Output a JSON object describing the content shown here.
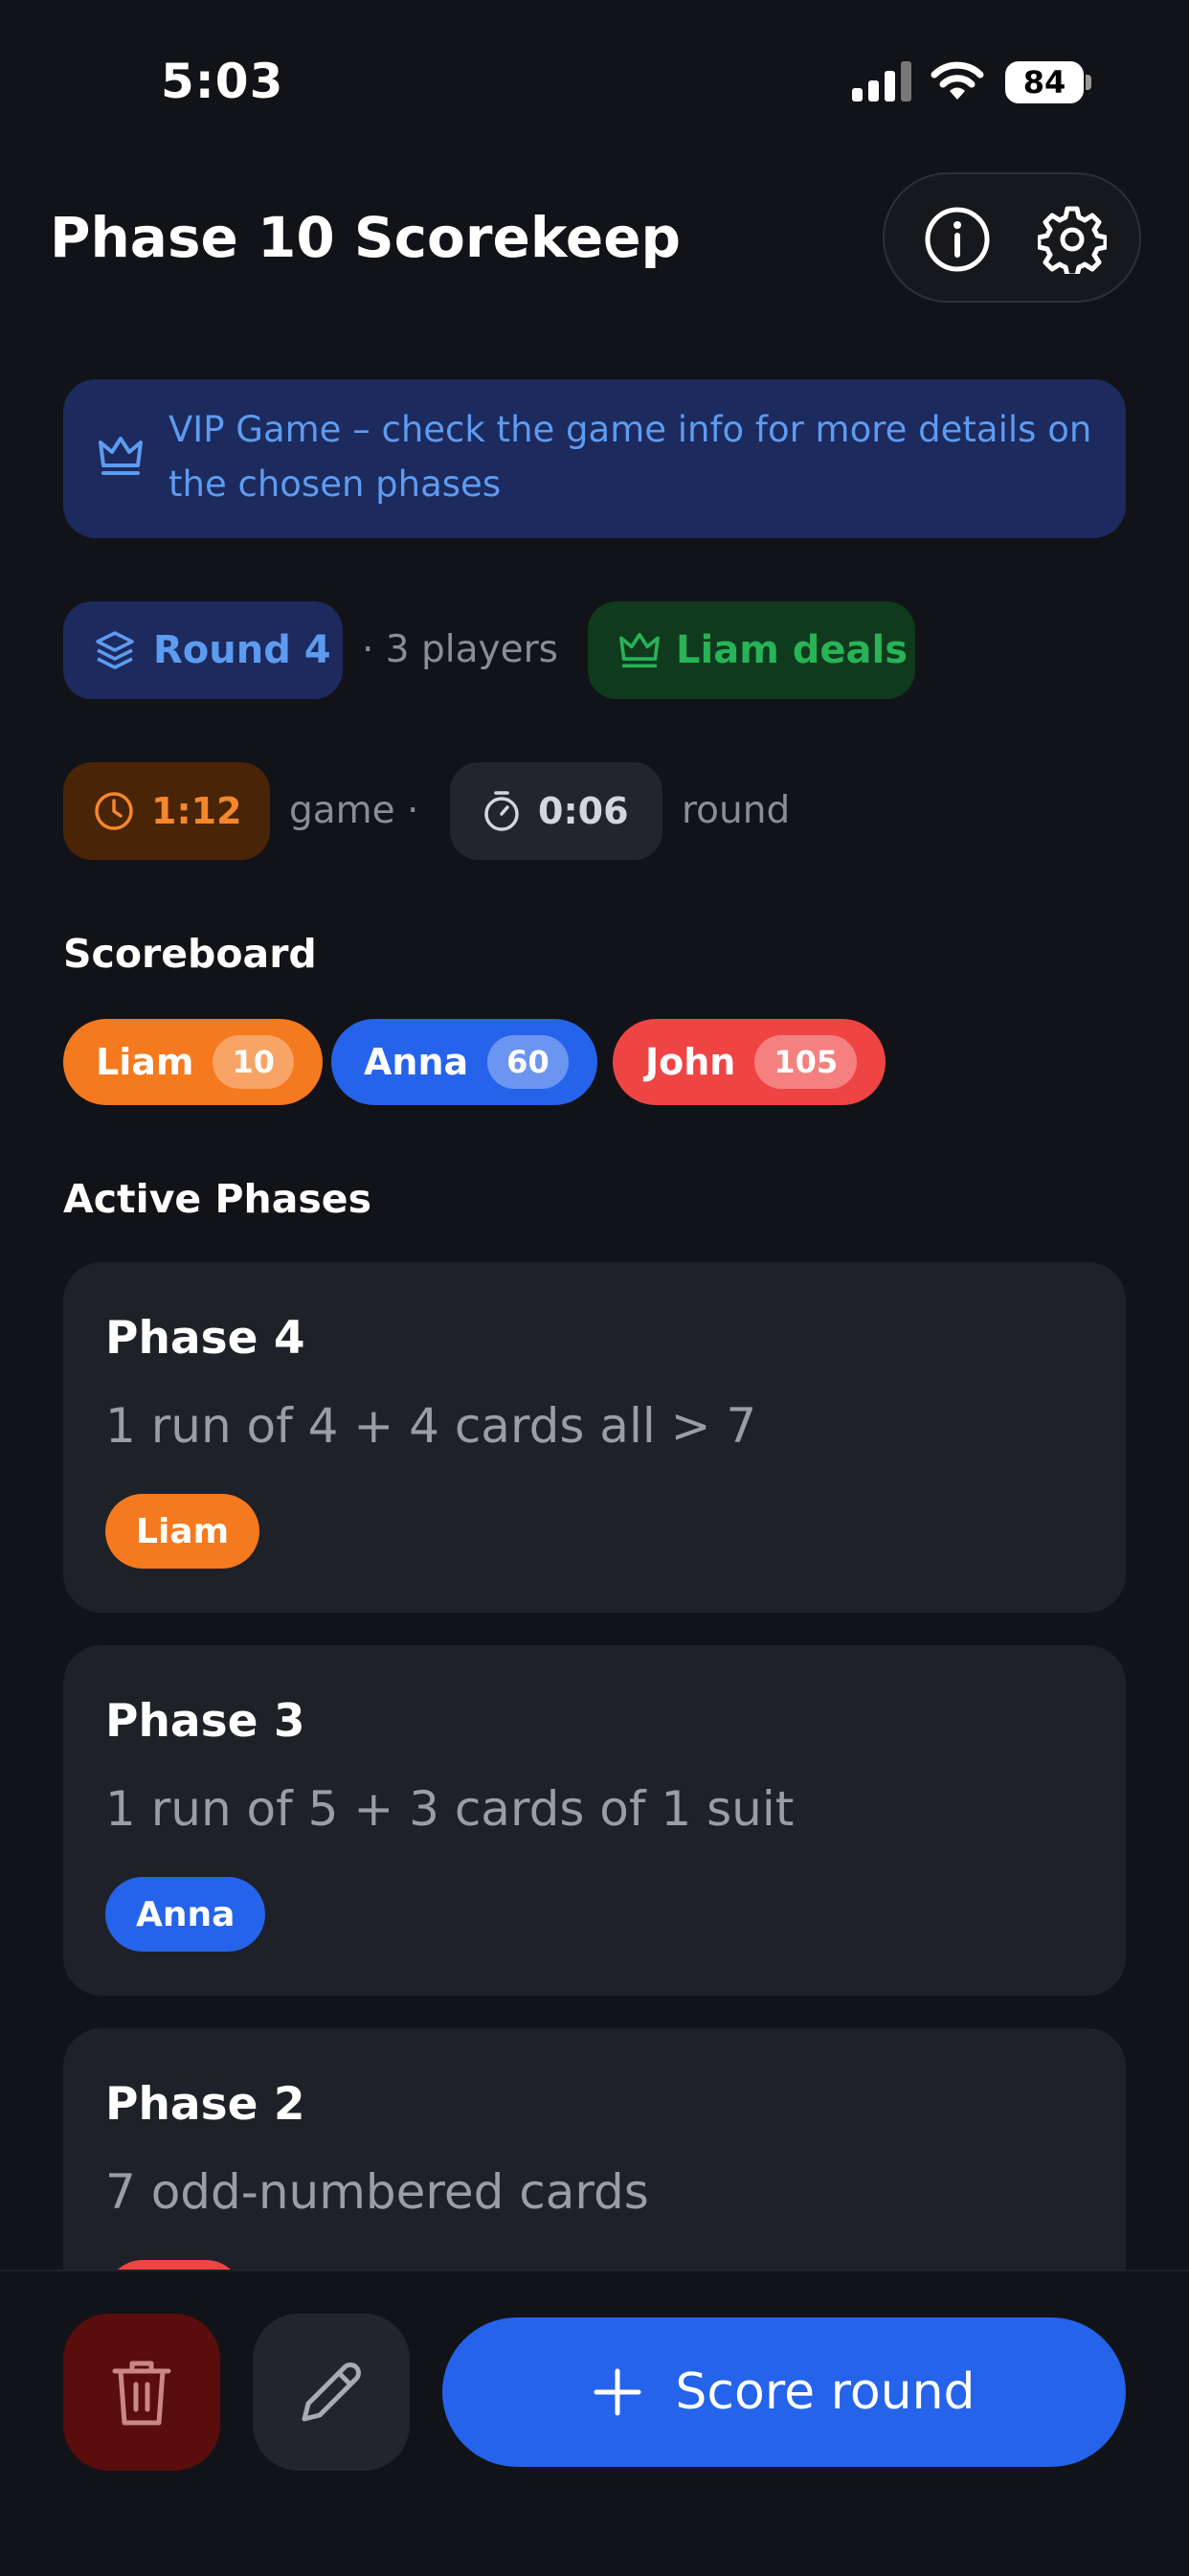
{
  "status_bar": {
    "time": "5:03",
    "battery": "84"
  },
  "header": {
    "title": "Phase 10 Scorekeep"
  },
  "vip_banner": {
    "text": "VIP Game – check the game info for more details on the chosen phases"
  },
  "round_info": {
    "round": "Round 4",
    "players": "· 3 players",
    "dealer": "Liam deals"
  },
  "timers": {
    "game_time": "1:12",
    "game_label": "game ·",
    "round_time": "0:06",
    "round_label": "round"
  },
  "scoreboard": {
    "heading": "Scoreboard",
    "players": [
      {
        "name": "Liam",
        "score": "10",
        "color": "#f5791e"
      },
      {
        "name": "Anna",
        "score": "60",
        "color": "#2563eb"
      },
      {
        "name": "John",
        "score": "105",
        "color": "#ef4444"
      }
    ]
  },
  "active_phases": {
    "heading": "Active Phases",
    "phases": [
      {
        "title": "Phase 4",
        "description": "1 run of 4 + 4 cards all > 7",
        "player": "Liam"
      },
      {
        "title": "Phase 3",
        "description": "1 run of 5 + 3 cards of 1 suit",
        "player": "Anna"
      },
      {
        "title": "Phase 2",
        "description": "7 odd-numbered cards",
        "player": ""
      }
    ]
  },
  "actions": {
    "score_round": "Score round"
  },
  "icons": [
    "info-icon",
    "gear-icon",
    "crown-icon",
    "layers-icon",
    "clock-icon",
    "stopwatch-icon",
    "trash-icon",
    "pencil-icon",
    "plus-icon"
  ]
}
